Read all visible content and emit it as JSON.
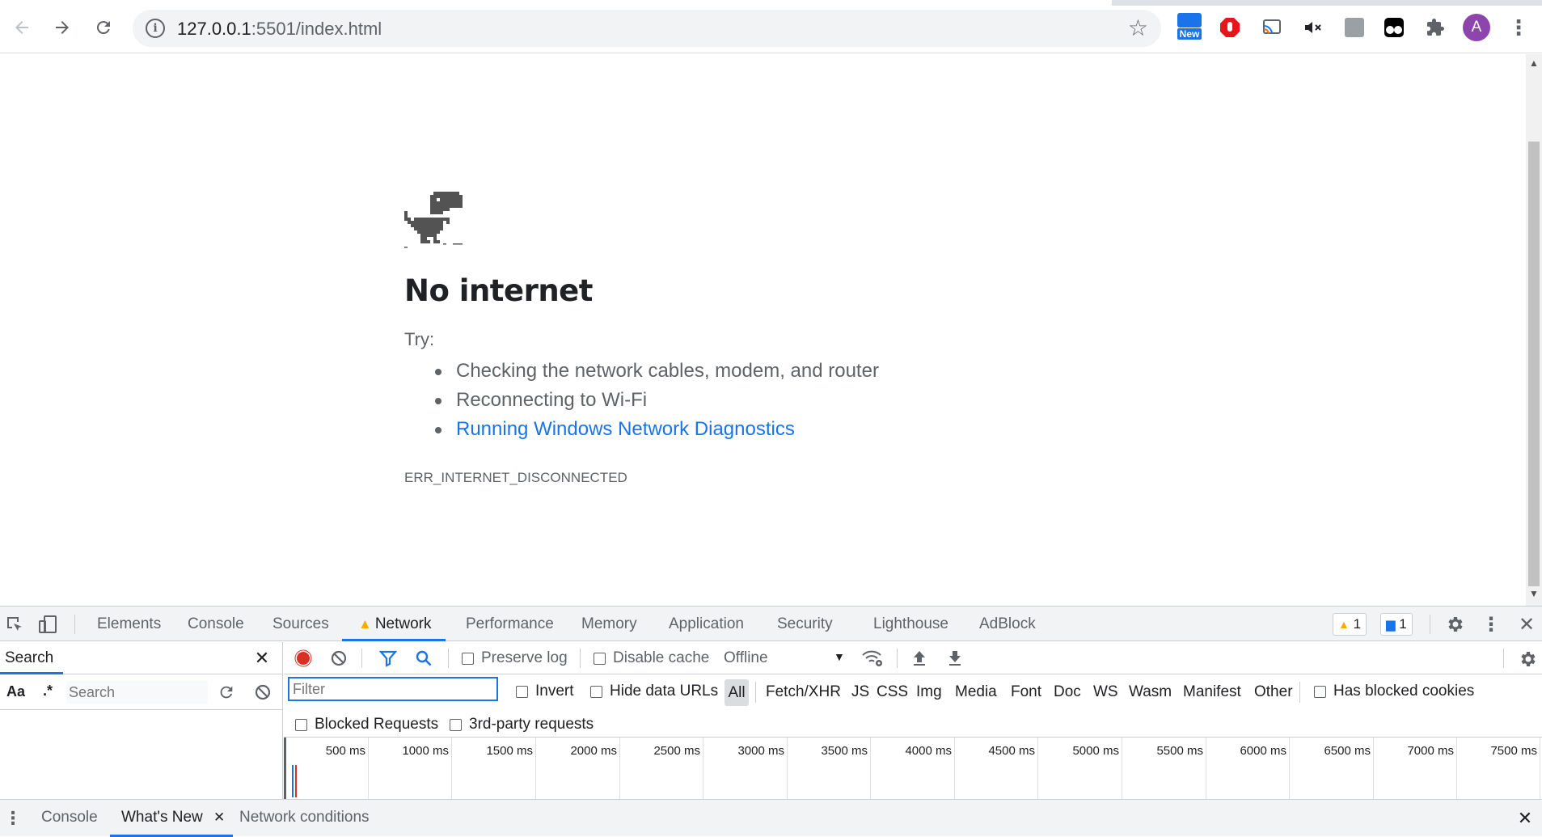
{
  "browser": {
    "url_host": "127.0.0.1",
    "url_rest": ":5501/index.html",
    "ext_new_badge": "New",
    "avatar_letter": "A"
  },
  "page": {
    "title": "No internet",
    "try_label": "Try:",
    "suggestions": [
      "Checking the network cables, modem, and router",
      "Reconnecting to Wi-Fi",
      "Running Windows Network Diagnostics"
    ],
    "error_code": "ERR_INTERNET_DISCONNECTED"
  },
  "devtools": {
    "tabs": [
      "Elements",
      "Console",
      "Sources",
      "Network",
      "Performance",
      "Memory",
      "Application",
      "Security",
      "Lighthouse",
      "AdBlock"
    ],
    "warnings_count": "1",
    "messages_count": "1",
    "search_panel": {
      "title": "Search",
      "case_label": "Aa",
      "regex_label": ".*",
      "input_placeholder": "Search"
    },
    "network": {
      "preserve_log": "Preserve log",
      "disable_cache": "Disable cache",
      "throttling": "Offline",
      "filter_placeholder": "Filter",
      "invert": "Invert",
      "hide_data_urls": "Hide data URLs",
      "types": [
        "All",
        "Fetch/XHR",
        "JS",
        "CSS",
        "Img",
        "Media",
        "Font",
        "Doc",
        "WS",
        "Wasm",
        "Manifest",
        "Other"
      ],
      "has_blocked_cookies": "Has blocked cookies",
      "blocked_requests": "Blocked Requests",
      "third_party": "3rd-party requests",
      "timeline_ticks": [
        "500 ms",
        "1000 ms",
        "1500 ms",
        "2000 ms",
        "2500 ms",
        "3000 ms",
        "3500 ms",
        "4000 ms",
        "4500 ms",
        "5000 ms",
        "5500 ms",
        "6000 ms",
        "6500 ms",
        "7000 ms",
        "7500 ms"
      ]
    },
    "drawer_tabs": [
      "Console",
      "What's New",
      "Network conditions"
    ]
  },
  "colors": {
    "accent": "#1a73e8",
    "record_red": "#d93025",
    "warning": "#f9ab00"
  }
}
